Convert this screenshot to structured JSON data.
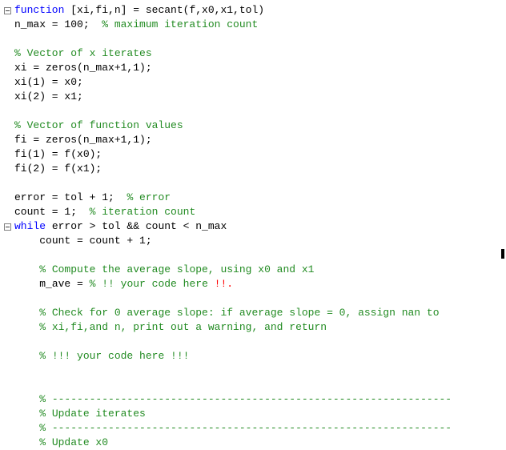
{
  "lines": [
    {
      "fold": true,
      "indent": "",
      "segs": [
        {
          "c": "kw",
          "t": "function"
        },
        {
          "c": "pl",
          "t": " [xi,fi,n] = secant(f,x0,x1,tol)"
        }
      ]
    },
    {
      "fold": false,
      "indent": "",
      "segs": [
        {
          "c": "pl",
          "t": "n_max = 100;  "
        },
        {
          "c": "cm",
          "t": "% maximum iteration count"
        }
      ]
    },
    {
      "fold": false,
      "indent": "",
      "segs": []
    },
    {
      "fold": false,
      "indent": "",
      "segs": [
        {
          "c": "cm",
          "t": "% Vector of x iterates"
        }
      ]
    },
    {
      "fold": false,
      "indent": "",
      "segs": [
        {
          "c": "pl",
          "t": "xi = zeros(n_max+1,1);"
        }
      ]
    },
    {
      "fold": false,
      "indent": "",
      "segs": [
        {
          "c": "pl",
          "t": "xi(1) = x0;"
        }
      ]
    },
    {
      "fold": false,
      "indent": "",
      "segs": [
        {
          "c": "pl",
          "t": "xi(2) = x1;"
        }
      ]
    },
    {
      "fold": false,
      "indent": "",
      "segs": []
    },
    {
      "fold": false,
      "indent": "",
      "segs": [
        {
          "c": "cm",
          "t": "% Vector of function values"
        }
      ]
    },
    {
      "fold": false,
      "indent": "",
      "segs": [
        {
          "c": "pl",
          "t": "fi = zeros(n_max+1,1);"
        }
      ]
    },
    {
      "fold": false,
      "indent": "",
      "segs": [
        {
          "c": "pl",
          "t": "fi(1) = f(x0);"
        }
      ]
    },
    {
      "fold": false,
      "indent": "",
      "segs": [
        {
          "c": "pl",
          "t": "fi(2) = f(x1);"
        }
      ]
    },
    {
      "fold": false,
      "indent": "",
      "segs": []
    },
    {
      "fold": false,
      "indent": "",
      "segs": [
        {
          "c": "pl",
          "t": "error = tol + 1;  "
        },
        {
          "c": "cm",
          "t": "% error"
        }
      ]
    },
    {
      "fold": false,
      "indent": "",
      "segs": [
        {
          "c": "pl",
          "t": "count = 1;  "
        },
        {
          "c": "cm",
          "t": "% iteration count"
        }
      ]
    },
    {
      "fold": true,
      "indent": "",
      "segs": [
        {
          "c": "kw",
          "t": "while"
        },
        {
          "c": "pl",
          "t": " error > tol && count < n_max"
        }
      ]
    },
    {
      "fold": false,
      "indent": "    ",
      "segs": [
        {
          "c": "pl",
          "t": "count = count + 1;"
        }
      ]
    },
    {
      "fold": false,
      "indent": "",
      "segs": []
    },
    {
      "fold": false,
      "indent": "    ",
      "segs": [
        {
          "c": "cm",
          "t": "% Compute the average slope, using x0 and x1"
        }
      ]
    },
    {
      "fold": false,
      "indent": "    ",
      "segs": [
        {
          "c": "pl",
          "t": "m_ave = "
        },
        {
          "c": "cm",
          "t": "% !! your code here "
        },
        {
          "c": "err",
          "t": "!!."
        }
      ]
    },
    {
      "fold": false,
      "indent": "",
      "segs": []
    },
    {
      "fold": false,
      "indent": "    ",
      "segs": [
        {
          "c": "cm",
          "t": "% Check for 0 average slope: if average slope = 0, assign nan to"
        }
      ]
    },
    {
      "fold": false,
      "indent": "    ",
      "segs": [
        {
          "c": "cm",
          "t": "% xi,fi,and n, print out a warning, and return"
        }
      ]
    },
    {
      "fold": false,
      "indent": "",
      "segs": []
    },
    {
      "fold": false,
      "indent": "    ",
      "segs": [
        {
          "c": "cm",
          "t": "% !!! your code here !!!"
        }
      ]
    },
    {
      "fold": false,
      "indent": "",
      "segs": []
    },
    {
      "fold": false,
      "indent": "",
      "segs": []
    },
    {
      "fold": false,
      "indent": "    ",
      "segs": [
        {
          "c": "cm",
          "t": "% ----------------------------------------------------------------"
        }
      ]
    },
    {
      "fold": false,
      "indent": "    ",
      "segs": [
        {
          "c": "cm",
          "t": "% Update iterates"
        }
      ]
    },
    {
      "fold": false,
      "indent": "    ",
      "segs": [
        {
          "c": "cm",
          "t": "% ----------------------------------------------------------------"
        }
      ]
    },
    {
      "fold": false,
      "indent": "    ",
      "segs": [
        {
          "c": "cm",
          "t": "% Update x0"
        }
      ]
    }
  ]
}
